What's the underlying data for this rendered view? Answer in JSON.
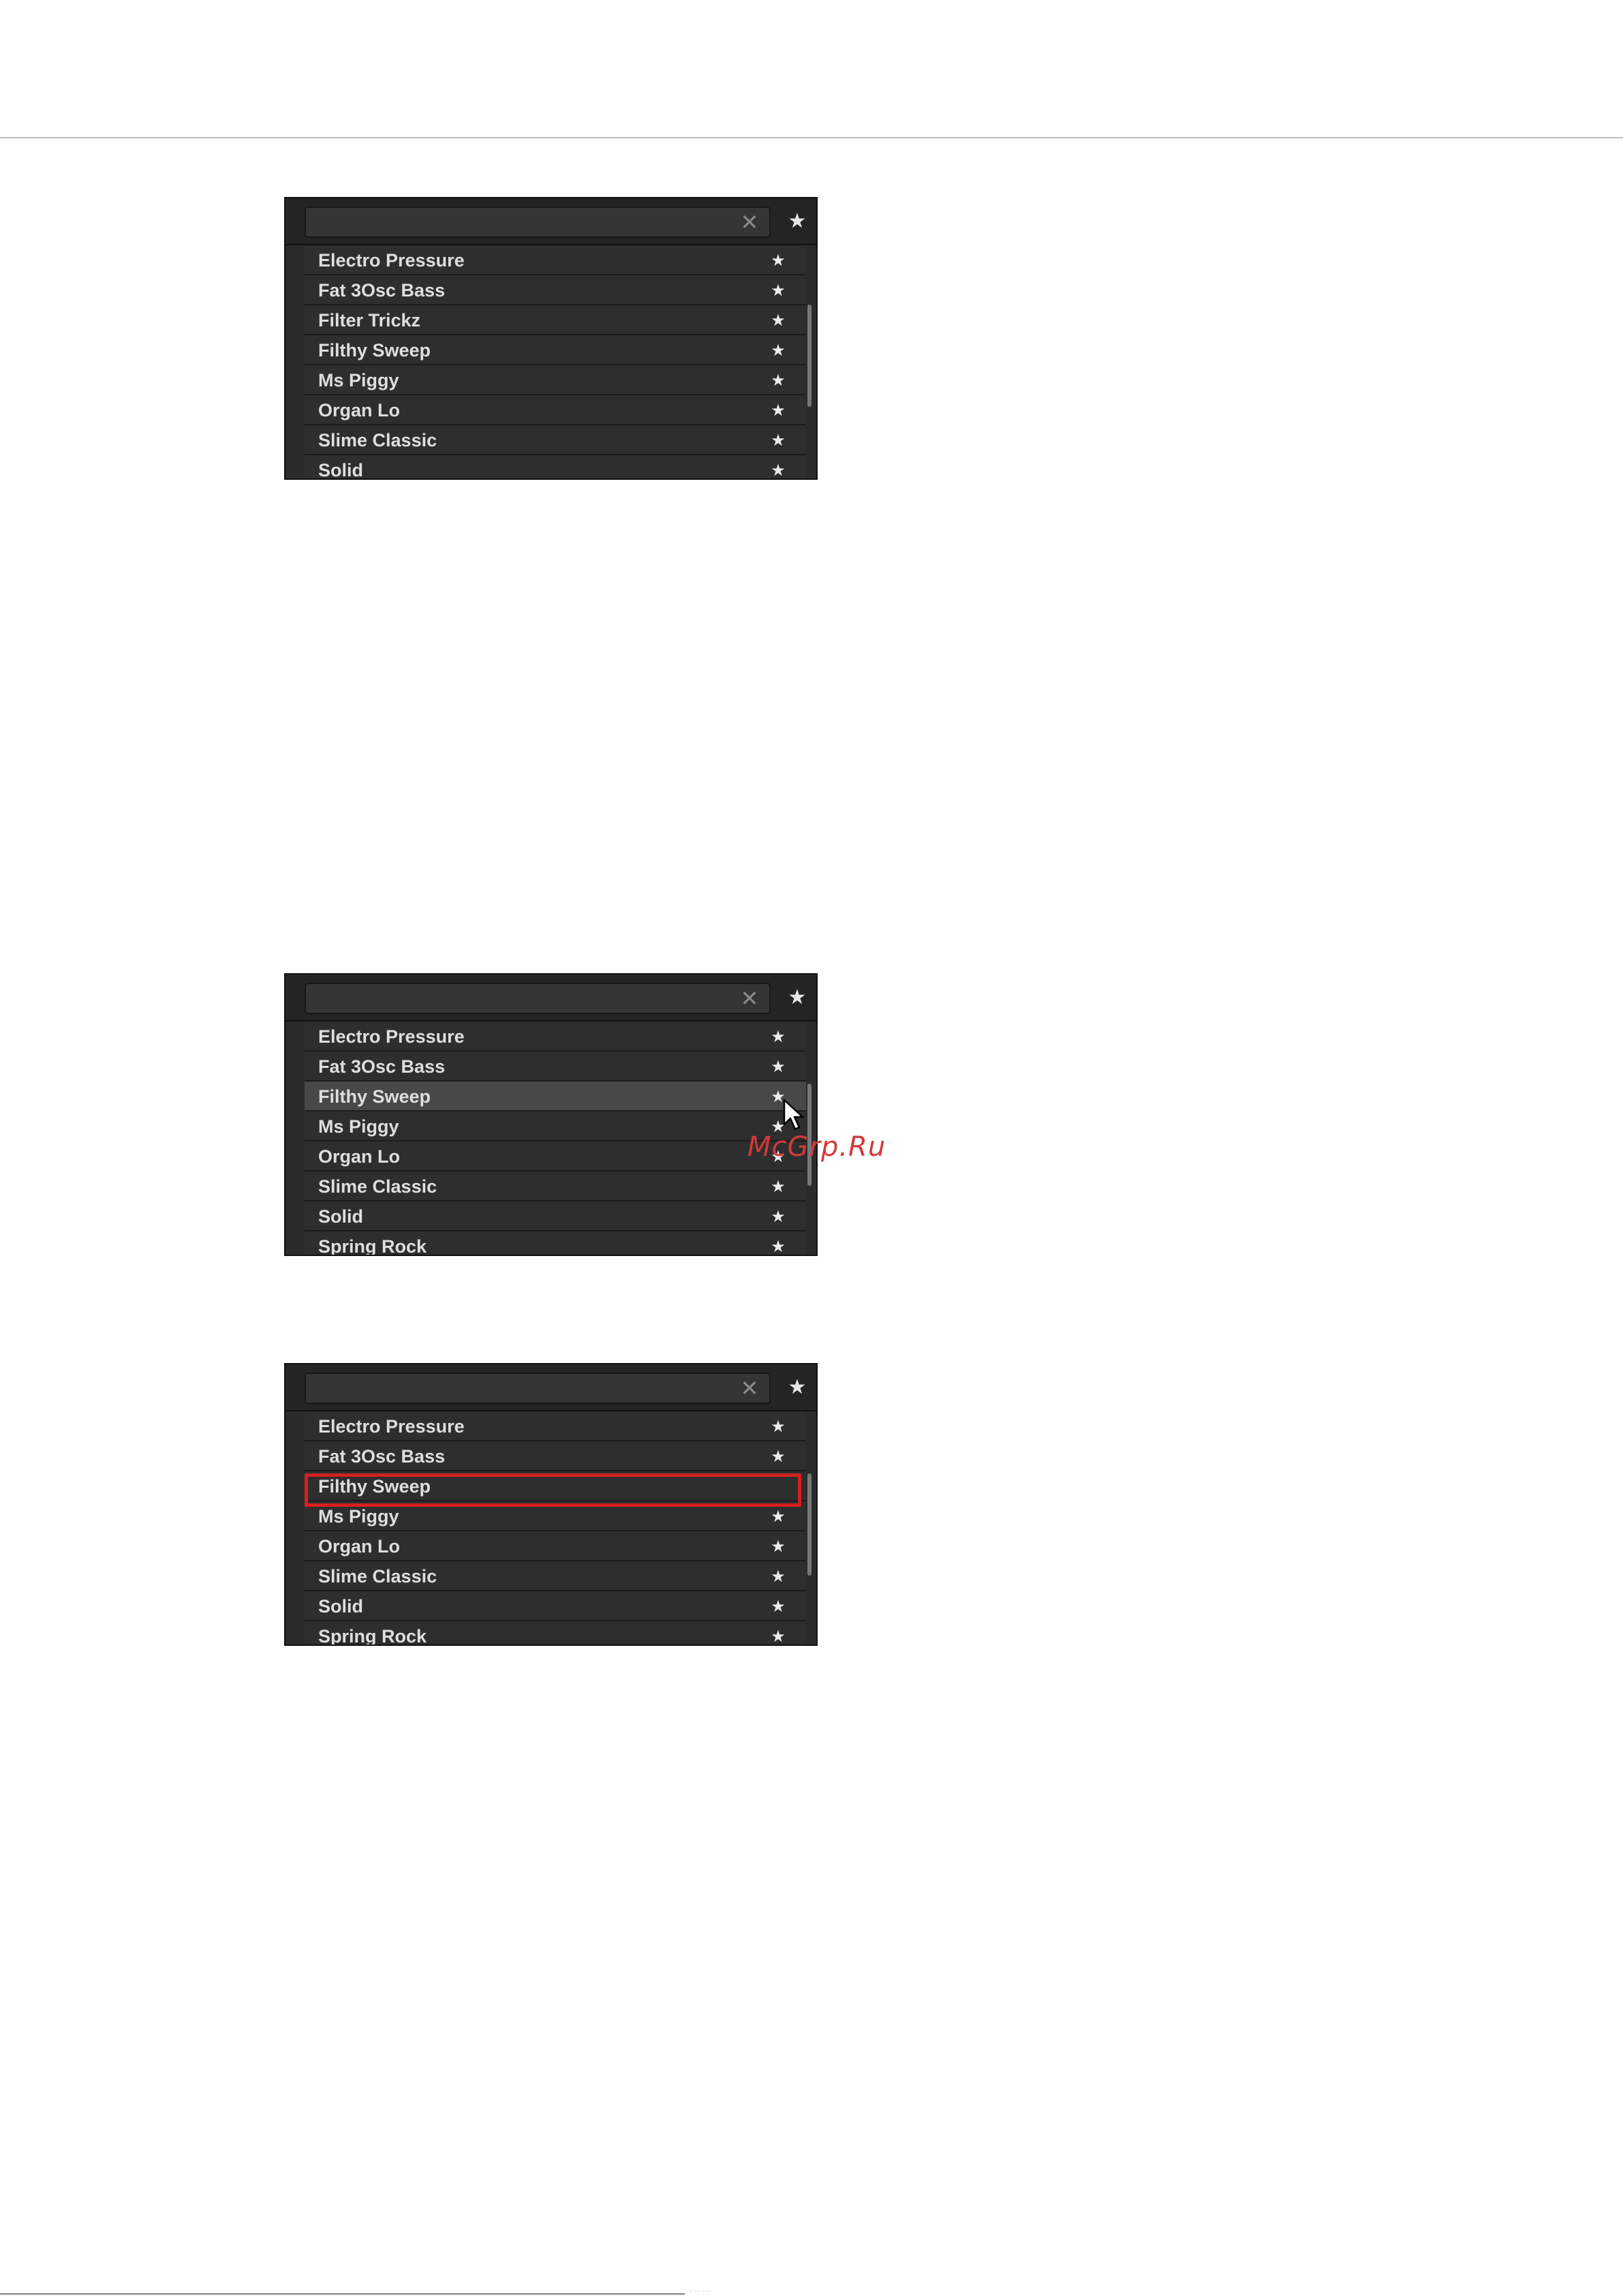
{
  "screens": [
    {
      "search": {
        "value": "",
        "clear_glyph": "✕",
        "favorites_glyph": "★"
      },
      "items": [
        {
          "label": "Electro Pressure",
          "star": "★"
        },
        {
          "label": "Fat 3Osc Bass",
          "star": "★"
        },
        {
          "label": "Filter Trickz",
          "star": "★"
        },
        {
          "label": "Filthy Sweep",
          "star": "★"
        },
        {
          "label": "Ms Piggy",
          "star": "★"
        },
        {
          "label": "Organ Lo",
          "star": "★"
        },
        {
          "label": "Slime Classic",
          "star": "★"
        },
        {
          "label": "Solid",
          "star": "★"
        }
      ]
    },
    {
      "search": {
        "value": "",
        "clear_glyph": "✕",
        "favorites_glyph": "★"
      },
      "items": [
        {
          "label": "Electro Pressure",
          "star": "★"
        },
        {
          "label": "Fat 3Osc Bass",
          "star": "★"
        },
        {
          "label": "Filthy Sweep",
          "star": "★",
          "state": "hover"
        },
        {
          "label": "Ms Piggy",
          "star": "★"
        },
        {
          "label": "Organ Lo",
          "star": "★"
        },
        {
          "label": "Slime Classic",
          "star": "★"
        },
        {
          "label": "Solid",
          "star": "★"
        },
        {
          "label": "Spring Rock",
          "star": "★"
        }
      ]
    },
    {
      "search": {
        "value": "",
        "clear_glyph": "✕",
        "favorites_glyph": "★"
      },
      "items": [
        {
          "label": "Electro Pressure",
          "star": "★"
        },
        {
          "label": "Fat 3Osc Bass",
          "star": "★"
        },
        {
          "label": "Filthy Sweep",
          "star": "",
          "state": "highlighted"
        },
        {
          "label": "Ms Piggy",
          "star": "★"
        },
        {
          "label": "Organ Lo",
          "star": "★"
        },
        {
          "label": "Slime Classic",
          "star": "★"
        },
        {
          "label": "Solid",
          "star": "★"
        },
        {
          "label": "Spring Rock",
          "star": "★"
        }
      ]
    }
  ],
  "watermark": "McGrp.Ru",
  "colors": {
    "panel_bg": "#2b2b2b",
    "row_bg": "#2e2e2e",
    "row_hover_bg": "#484848",
    "highlight": "#d42020",
    "watermark": "#d33a3a"
  },
  "icons": {
    "favorite": "star-icon",
    "clear": "clear-search-icon",
    "pointer": "mouse-cursor-icon"
  }
}
